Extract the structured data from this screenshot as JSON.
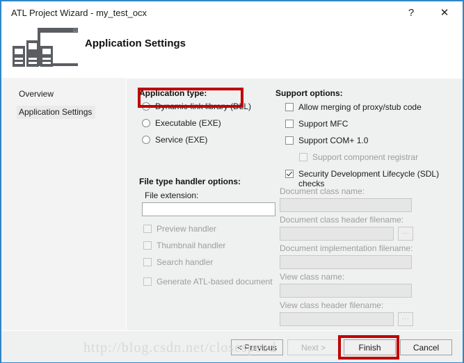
{
  "window": {
    "title": "ATL Project Wizard - my_test_ocx",
    "help_glyph": "?",
    "close_glyph": "✕",
    "accent_color": "#2e86c8"
  },
  "header": {
    "title": "Application Settings",
    "icon": "wizard-app-settings-icon"
  },
  "nav": {
    "items": [
      {
        "label": "Overview",
        "selected": false
      },
      {
        "label": "Application Settings",
        "selected": true
      }
    ]
  },
  "application_type": {
    "group_label": "Application type:",
    "options": [
      {
        "label": "Dynamic-link library (DLL)",
        "checked": true
      },
      {
        "label": "Executable (EXE)",
        "checked": false
      },
      {
        "label": "Service (EXE)",
        "checked": false
      }
    ]
  },
  "support_options": {
    "group_label": "Support options:",
    "options": [
      {
        "label": "Allow merging of proxy/stub code",
        "checked": false,
        "disabled": false
      },
      {
        "label": "Support MFC",
        "checked": false,
        "disabled": false
      },
      {
        "label": "Support COM+ 1.0",
        "checked": false,
        "disabled": false
      },
      {
        "label": "Support component registrar",
        "checked": false,
        "disabled": true
      },
      {
        "label": "Security Development Lifecycle (SDL) checks",
        "checked": true,
        "disabled": false
      }
    ]
  },
  "file_type_handler": {
    "group_label": "File type handler options:",
    "file_extension_label": "File extension:",
    "file_extension_value": "",
    "options": [
      {
        "label": "Preview handler",
        "checked": false,
        "disabled": true
      },
      {
        "label": "Thumbnail handler",
        "checked": false,
        "disabled": true
      },
      {
        "label": "Search handler",
        "checked": false,
        "disabled": true
      },
      {
        "label": "Generate ATL-based document",
        "checked": false,
        "disabled": true
      }
    ]
  },
  "document_fields": [
    {
      "label": "Document class name:",
      "value": "",
      "browse": false
    },
    {
      "label": "Document class header filename:",
      "value": "",
      "browse": true
    },
    {
      "label": "Document implementation filename:",
      "value": "",
      "browse": false
    },
    {
      "label": "View class name:",
      "value": "",
      "browse": false
    },
    {
      "label": "View class header filename:",
      "value": "",
      "browse": true
    }
  ],
  "browse_button_label": "...",
  "footer": {
    "previous_label": "< Previous",
    "next_label": "Next >",
    "finish_label": "Finish",
    "cancel_label": "Cancel"
  },
  "annotations": {
    "highlight_color": "#c00000",
    "watermark_text": "http://blog.csdn.net/closespeed"
  }
}
